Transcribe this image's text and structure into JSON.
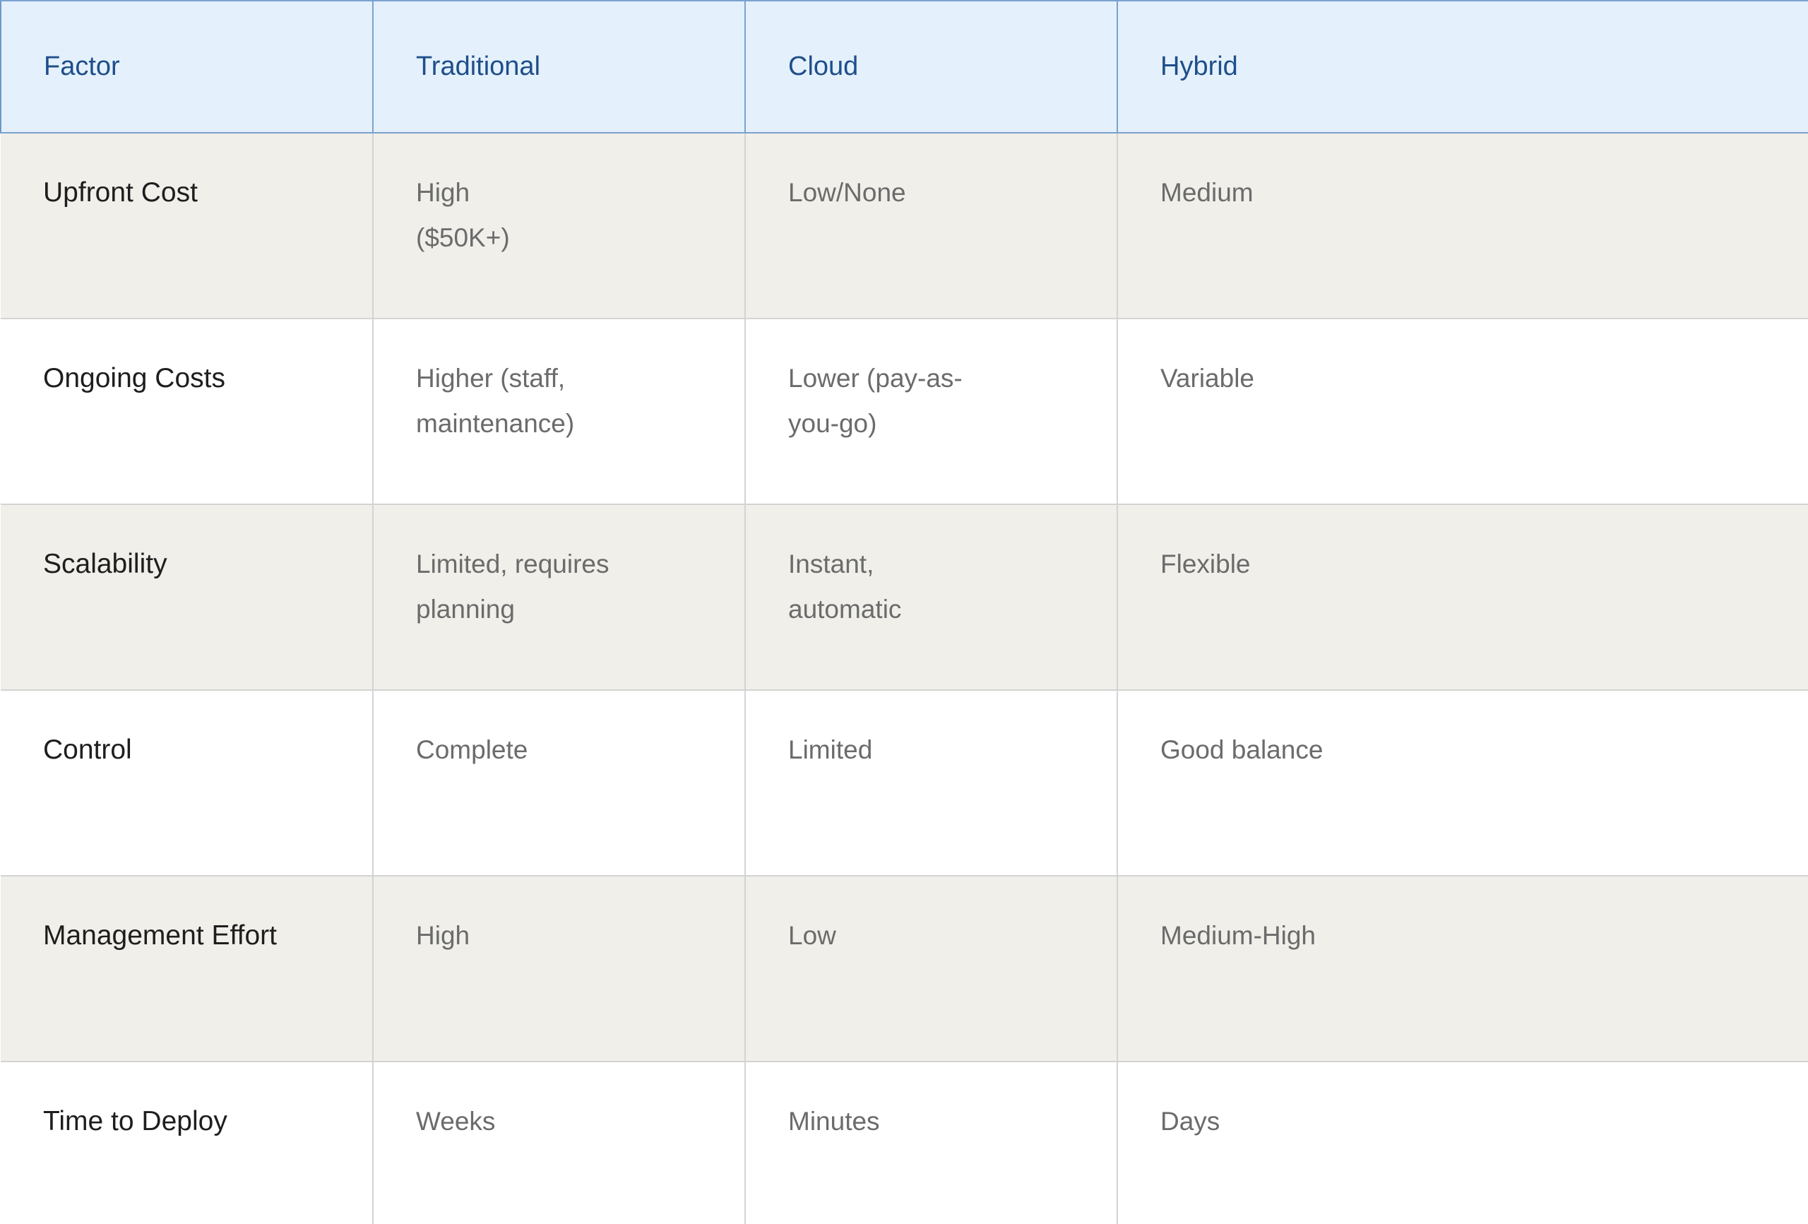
{
  "table": {
    "headers": [
      "Factor",
      "Traditional",
      "Cloud",
      "Hybrid"
    ],
    "rows": [
      [
        "Upfront Cost",
        "High\n($50K+)",
        "Low/None",
        "Medium"
      ],
      [
        "Ongoing Costs",
        "Higher (staff,\nmaintenance)",
        "Lower (pay-as-\nyou-go)",
        "Variable"
      ],
      [
        "Scalability",
        "Limited, requires\nplanning",
        "Instant,\nautomatic",
        "Flexible"
      ],
      [
        "Control",
        "Complete",
        "Limited",
        "Good balance"
      ],
      [
        "Management Effort",
        "High",
        "Low",
        "Medium-High"
      ],
      [
        "Time to Deploy",
        "Weeks",
        "Minutes",
        "Days"
      ]
    ]
  },
  "colors": {
    "header_background": "#e4f1fc",
    "header_text": "#1f4e8a",
    "row_alt_background": "#f0efea",
    "factor_text": "#1e1e1e",
    "value_text": "#6b6b6b"
  }
}
